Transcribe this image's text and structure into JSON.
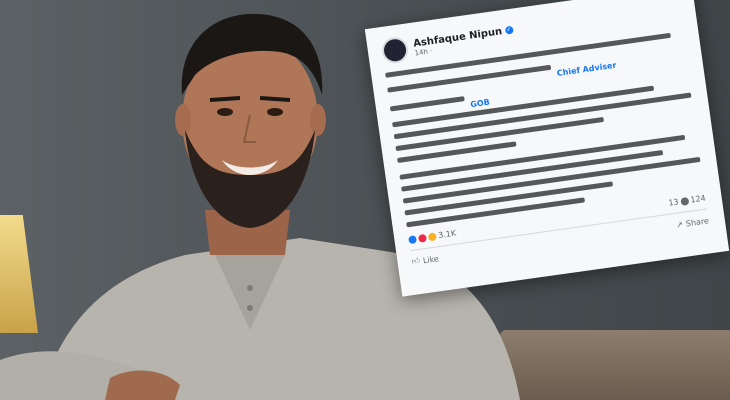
{
  "post": {
    "author": "Ashfaque Nipun",
    "time": "14h · ",
    "highlight_1": "Chief Adviser",
    "highlight_2": "GOB",
    "reactions_count": "3.1K",
    "comments_count": "124",
    "shares_count": "13",
    "like_label": "Like",
    "share_label": "Share"
  },
  "colors": {
    "facebook_blue": "#1877f2",
    "post_bg": "#f7f8fa"
  }
}
